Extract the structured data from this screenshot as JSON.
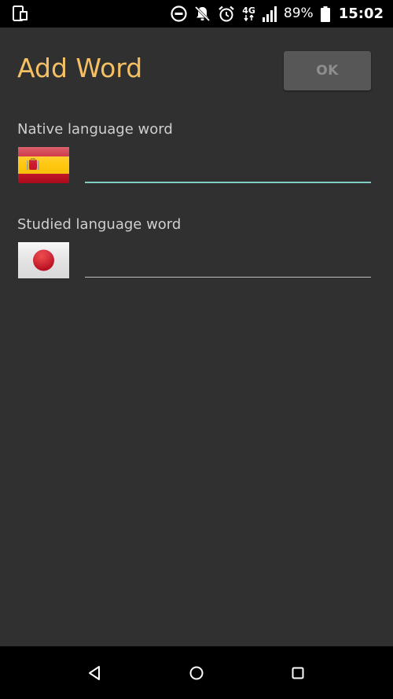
{
  "status_bar": {
    "network": "4G",
    "battery": "89%",
    "time": "15:02",
    "icons": [
      "device-icon",
      "dnd-icon",
      "notifications-off-icon",
      "alarm-icon",
      "network-4g-icon",
      "signal-icon",
      "battery-icon"
    ]
  },
  "header": {
    "title": "Add Word",
    "ok_label": "OK"
  },
  "form": {
    "native": {
      "label": "Native language word",
      "value": "",
      "flag": "spain-flag"
    },
    "studied": {
      "label": "Studied language word",
      "value": "",
      "flag": "japan-flag"
    }
  },
  "nav_bar": {
    "icons": [
      "back-icon",
      "home-icon",
      "recents-icon"
    ]
  },
  "colors": {
    "title": "#f4c063",
    "focused_underline": "#80cbc4",
    "background": "#303030"
  }
}
